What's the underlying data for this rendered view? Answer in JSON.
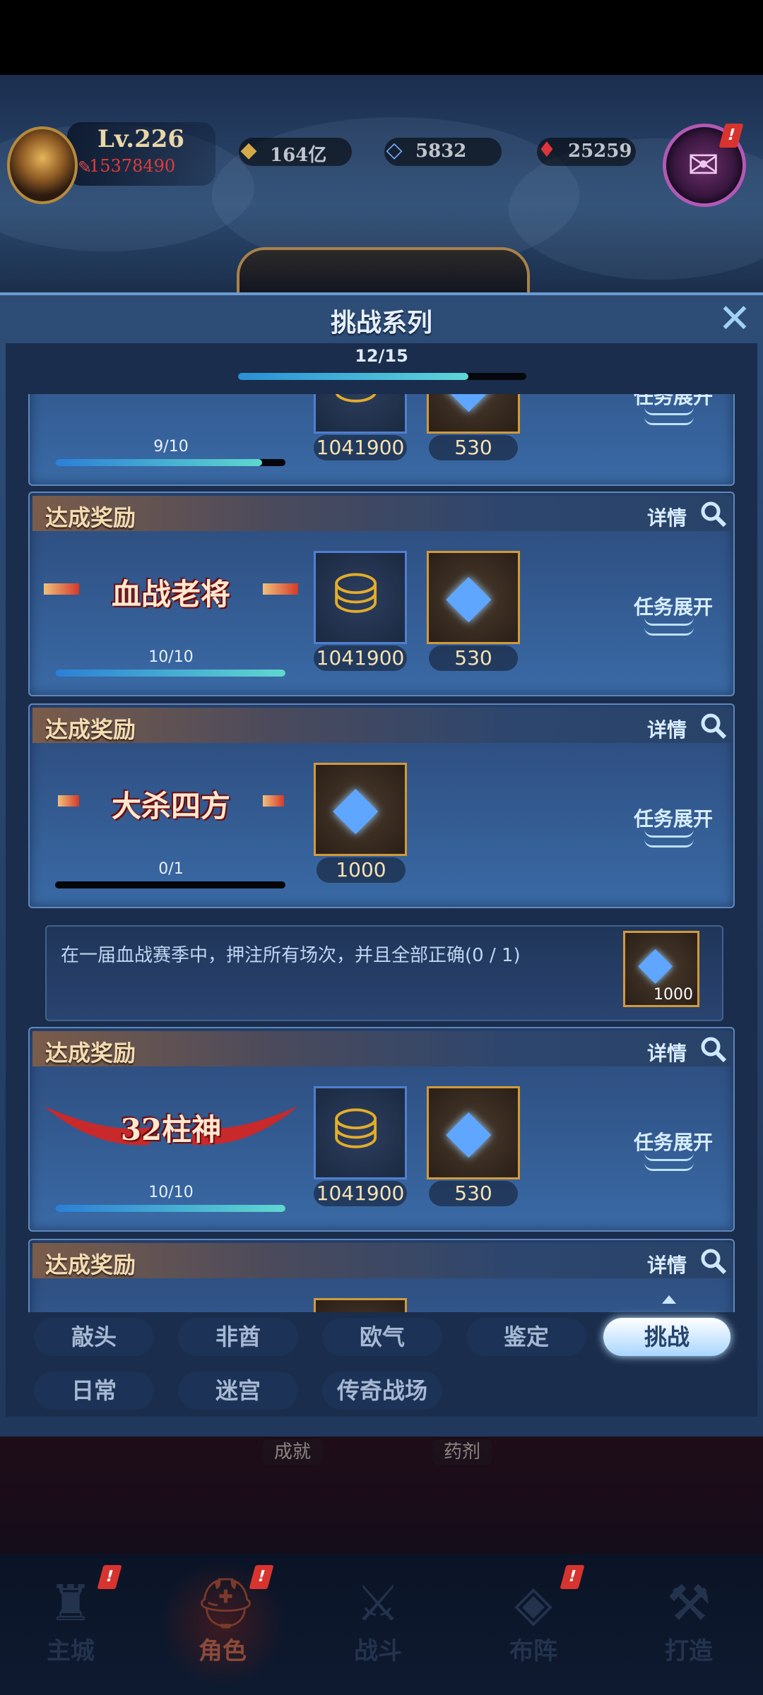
{
  "player": {
    "level": "Lv.226",
    "power": "15378490",
    "currencies": [
      {
        "name": "gold",
        "value": "164亿",
        "icon": "gold-ingot-icon"
      },
      {
        "name": "diamond",
        "value": "5832",
        "icon": "diamond-icon"
      },
      {
        "name": "ruby",
        "value": "25259",
        "icon": "ruby-icon"
      }
    ],
    "event_badge": "!"
  },
  "modal": {
    "title": "挑战系列",
    "progress_label": "12/15",
    "progress_fraction": 0.8,
    "close_icon": "close-icon"
  },
  "cards": [
    {
      "header": "",
      "tag": "",
      "progress_label": "9/10",
      "progress_fraction": 0.9,
      "rewards": [
        {
          "type": "gold",
          "value": "1041900"
        },
        {
          "type": "diamond",
          "value": "530"
        }
      ],
      "expand_label": "任务展开"
    },
    {
      "header": "达成奖励",
      "detail": "详情",
      "tag": "血战老将",
      "progress_label": "10/10",
      "progress_fraction": 1.0,
      "rewards": [
        {
          "type": "gold",
          "value": "1041900"
        },
        {
          "type": "diamond",
          "value": "530"
        }
      ],
      "expand_label": "任务展开"
    },
    {
      "header": "达成奖励",
      "detail": "详情",
      "tag": "大杀四方",
      "progress_label": "0/1",
      "progress_fraction": 0.0,
      "rewards": [
        {
          "type": "diamond",
          "value": "1000"
        }
      ],
      "expand_label": "任务展开",
      "task": {
        "text": "在一届血战赛季中，押注所有场次，并且全部正确(0 / 1)",
        "reward_value": "1000"
      }
    },
    {
      "header": "达成奖励",
      "detail": "详情",
      "tag": "32柱神",
      "progress_label": "10/10",
      "progress_fraction": 1.0,
      "rewards": [
        {
          "type": "gold",
          "value": "1041900"
        },
        {
          "type": "diamond",
          "value": "530"
        }
      ],
      "expand_label": "任务展开"
    },
    {
      "header": "达成奖励",
      "detail": "详情"
    }
  ],
  "tabs": {
    "row1": [
      "敲头",
      "非酋",
      "欧气",
      "鉴定",
      "挑战"
    ],
    "row2": [
      "日常",
      "迷宫",
      "传奇战场"
    ],
    "active": "挑战"
  },
  "scene_labels": [
    "成就",
    "药剂"
  ],
  "bottom_nav": [
    {
      "label": "主城",
      "icon": "castle-icon",
      "badge": "!"
    },
    {
      "label": "角色",
      "icon": "helmet-icon",
      "badge": "!",
      "active": true
    },
    {
      "label": "战斗",
      "icon": "crossed-swords-icon"
    },
    {
      "label": "布阵",
      "icon": "formation-icon",
      "badge": "!"
    },
    {
      "label": "打造",
      "icon": "anvil-icon"
    }
  ],
  "colors": {
    "modal_bg": "#2d4d77",
    "card_header": "#f3dcb2",
    "progress_fill": "#5ed6d8",
    "active_tab": "#ffffff"
  }
}
